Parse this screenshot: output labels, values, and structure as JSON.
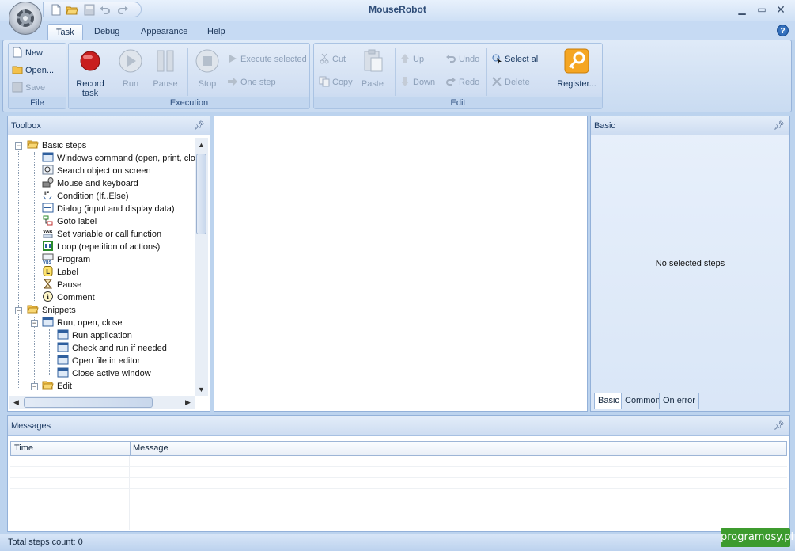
{
  "window": {
    "title": "MouseRobot"
  },
  "ribbon": {
    "tabs": [
      {
        "label": "Task",
        "active": true
      },
      {
        "label": "Debug"
      },
      {
        "label": "Appearance"
      },
      {
        "label": "Help"
      }
    ],
    "file": {
      "label": "File",
      "new": "New",
      "open": "Open...",
      "save": "Save"
    },
    "execution": {
      "label": "Execution",
      "record_1": "Record",
      "record_2": "task",
      "run": "Run",
      "pause": "Pause",
      "stop": "Stop",
      "execute_selected": "Execute selected",
      "one_step": "One step"
    },
    "edit": {
      "label": "Edit",
      "cut": "Cut",
      "copy": "Copy",
      "paste": "Paste",
      "up": "Up",
      "down": "Down",
      "undo": "Undo",
      "redo": "Redo",
      "select_all": "Select all",
      "delete": "Delete",
      "register": "Register..."
    }
  },
  "toolbox": {
    "title": "Toolbox",
    "basic_steps": "Basic steps",
    "items": [
      "Windows command (open, print, clo",
      "Search object on screen",
      "Mouse and keyboard",
      "Condition (If..Else)",
      "Dialog (input and display data)",
      "Goto label",
      "Set variable or call function",
      "Loop (repetition of actions)",
      "Program",
      "Label",
      "Pause",
      "Comment"
    ],
    "snippets": "Snippets",
    "run_open_close": "Run, open, close",
    "snippet_items": [
      "Run application",
      "Check and run if needed",
      "Open file in editor",
      "Close active window"
    ],
    "edit": "Edit"
  },
  "properties": {
    "title": "Basic",
    "empty_text": "No selected steps",
    "tabs": [
      {
        "label": "Basic",
        "active": true
      },
      {
        "label": "Common"
      },
      {
        "label": "On error"
      }
    ]
  },
  "messages": {
    "title": "Messages",
    "columns": [
      "Time",
      "Message"
    ]
  },
  "status": {
    "text": "Total steps count: 0"
  },
  "watermark": "programosy.pl",
  "colors": {
    "accent": "#3d9b2e",
    "panel_border": "#93b1d9"
  }
}
